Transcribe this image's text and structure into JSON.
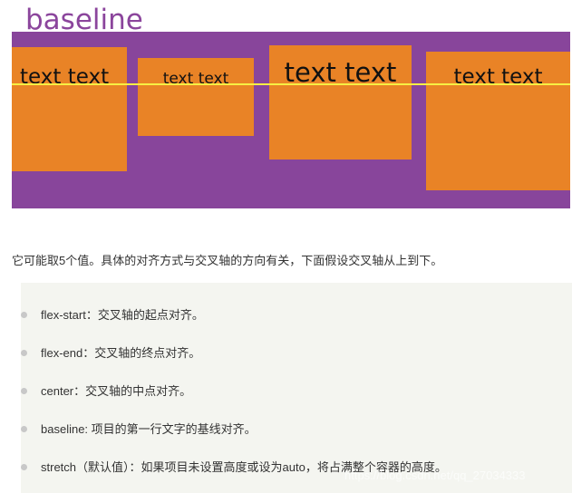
{
  "demo": {
    "title": "baseline",
    "colors": {
      "title": "#8b459c",
      "container": "#88459b",
      "item": "#e98326",
      "baseline_line": "#f7ef43"
    },
    "items": [
      {
        "label": "text text"
      },
      {
        "label": "text text"
      },
      {
        "label": "text text"
      },
      {
        "label": "text text"
      }
    ]
  },
  "article": {
    "intro": "它可能取5个值。具体的对齐方式与交叉轴的方向有关，下面假设交叉轴从上到下。",
    "values": [
      "flex-start：交叉轴的起点对齐。",
      "flex-end：交叉轴的终点对齐。",
      "center：交叉轴的中点对齐。",
      "baseline: 项目的第一行文字的基线对齐。",
      "stretch（默认值）：如果项目未设置高度或设为auto，将占满整个容器的高度。"
    ],
    "watermark": "https://blog.csdn.net/qq_27034333"
  }
}
